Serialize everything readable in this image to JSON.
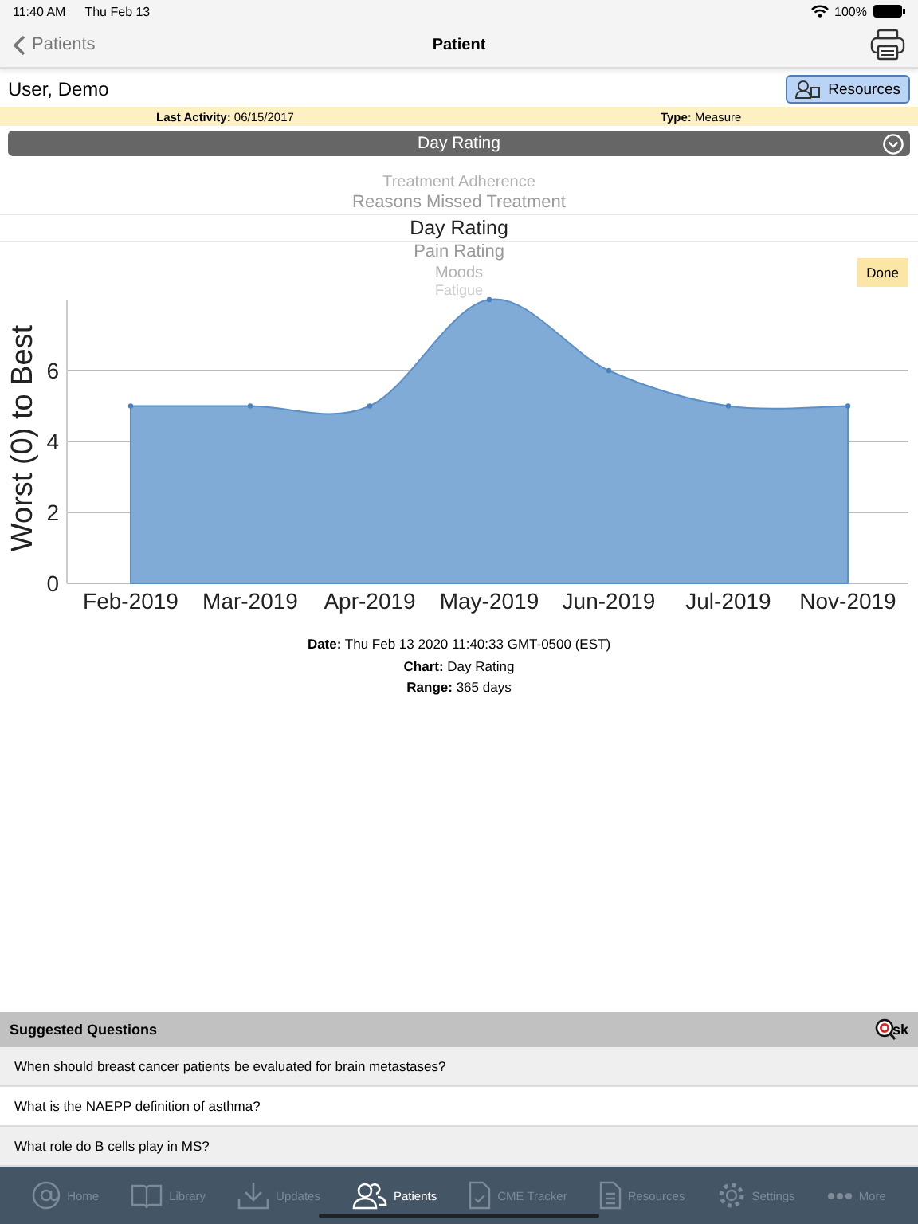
{
  "status_bar": {
    "time": "11:40 AM",
    "date": "Thu Feb 13",
    "battery": "100%"
  },
  "nav": {
    "back": "Patients",
    "title": "Patient"
  },
  "patient": {
    "name": "User, Demo",
    "resources_button": "Resources"
  },
  "activity": {
    "last_label": "Last Activity:",
    "last_value": "06/15/2017",
    "type_label": "Type:",
    "type_value": "Measure"
  },
  "dropdown": {
    "value": "Day Rating"
  },
  "picker": {
    "items": [
      {
        "label": "Treatment Adherence",
        "selected": false
      },
      {
        "label": "Reasons Missed Treatment",
        "selected": false
      },
      {
        "label": "Day Rating",
        "selected": true
      },
      {
        "label": "Pain Rating",
        "selected": false
      },
      {
        "label": "Moods",
        "selected": false
      },
      {
        "label": "Fatigue",
        "selected": false
      }
    ],
    "done": "Done"
  },
  "chart_data": {
    "type": "area",
    "ylabel": "Worst (0) to Best",
    "categories": [
      "Feb-2019",
      "Mar-2019",
      "Apr-2019",
      "May-2019",
      "Jun-2019",
      "Jul-2019",
      "Nov-2019"
    ],
    "series": [
      {
        "color": "#7fabd6",
        "values": [
          5,
          5,
          5,
          8,
          6,
          5,
          5
        ]
      }
    ],
    "grid": true,
    "ylim": [
      0,
      8
    ],
    "yticks": [
      0,
      2,
      4,
      6
    ]
  },
  "chart_info": [
    {
      "label": "Date:",
      "value": "Thu Feb 13 2020 11:40:33 GMT-0500 (EST)"
    },
    {
      "label": "Chart:",
      "value": "Day Rating"
    },
    {
      "label": "Range:",
      "value": "365 days"
    }
  ],
  "suggested": {
    "title": "Suggested Questions",
    "logo_text": "sk",
    "questions": [
      "When should breast cancer patients be evaluated for brain metastases?",
      "What is the NAEPP definition of asthma?",
      "What role do B cells play in MS?"
    ]
  },
  "tab_bar": [
    {
      "kind": "home",
      "label": "Home",
      "selected": false
    },
    {
      "kind": "library",
      "label": "Library",
      "selected": false
    },
    {
      "kind": "updates",
      "label": "Updates",
      "selected": false
    },
    {
      "kind": "patients",
      "label": "Patients",
      "selected": true
    },
    {
      "kind": "cme",
      "label": "CME Tracker",
      "selected": false
    },
    {
      "kind": "resources",
      "label": "Resources",
      "selected": false
    },
    {
      "kind": "settings",
      "label": "Settings",
      "selected": false
    },
    {
      "kind": "more",
      "label": "More",
      "selected": false
    }
  ]
}
